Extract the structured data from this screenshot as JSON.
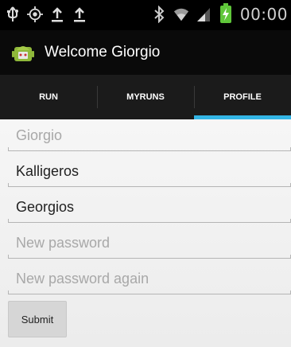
{
  "status_bar": {
    "time": "00:00",
    "icons": [
      "usb-icon",
      "gps-icon",
      "upload-icon",
      "upload-icon",
      "bluetooth-icon",
      "wifi-icon",
      "signal-icon",
      "battery-charging-icon"
    ]
  },
  "action_bar": {
    "title": "Welcome Giorgio",
    "icon": "android-app-icon"
  },
  "tabs": [
    {
      "label": "RUN",
      "active": false
    },
    {
      "label": "MYRUNS",
      "active": false
    },
    {
      "label": "PROFILE",
      "active": true
    }
  ],
  "form": {
    "username": {
      "value": "",
      "placeholder": "Giorgio"
    },
    "last_name": {
      "value": "Kalligeros",
      "placeholder": ""
    },
    "first_name": {
      "value": "Georgios",
      "placeholder": ""
    },
    "new_password": {
      "value": "",
      "placeholder": "New password"
    },
    "new_password_again": {
      "value": "",
      "placeholder": "New password again"
    },
    "submit_label": "Submit"
  },
  "colors": {
    "accent": "#33b5e5",
    "battery": "#5fc63a"
  }
}
